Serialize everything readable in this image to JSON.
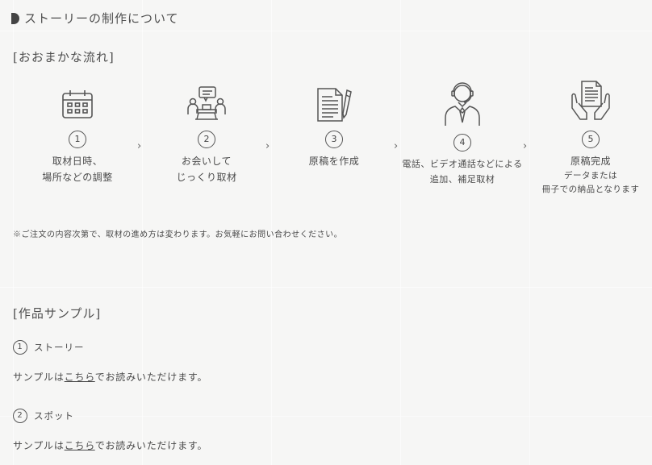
{
  "section": {
    "title": "ストーリーの制作について"
  },
  "flow": {
    "title": "[おおまかな流れ]",
    "steps": [
      {
        "num": "1",
        "icon": "calendar-icon",
        "line1": "取材日時、",
        "line2": "場所などの調整"
      },
      {
        "num": "2",
        "icon": "meeting-icon",
        "line1": "お会いして",
        "line2": "じっくり取材"
      },
      {
        "num": "3",
        "icon": "document-pen-icon",
        "line1": "原稿を作成",
        "line2": ""
      },
      {
        "num": "4",
        "icon": "operator-headset-icon",
        "line1": "電話、ビデオ通話などによる",
        "line2": "追加、補足取材"
      },
      {
        "num": "5",
        "icon": "hands-document-icon",
        "line1": "原稿完成",
        "line2": "データまたは",
        "line3": "冊子での納品となります"
      }
    ],
    "arrow": "›",
    "note": "※ご注文の内容次第で、取材の進め方は変わります。お気軽にお問い合わせください。"
  },
  "samples": {
    "title": "[作品サンプル]",
    "items": [
      {
        "num": "1",
        "label": "ストーリー",
        "text_before": "サンプルは",
        "link": "こちら",
        "text_after": "でお読みいただけます。"
      },
      {
        "num": "2",
        "label": "スポット",
        "text_before": "サンプルは",
        "link": "こちら",
        "text_after": "でお読みいただけます。"
      }
    ]
  }
}
